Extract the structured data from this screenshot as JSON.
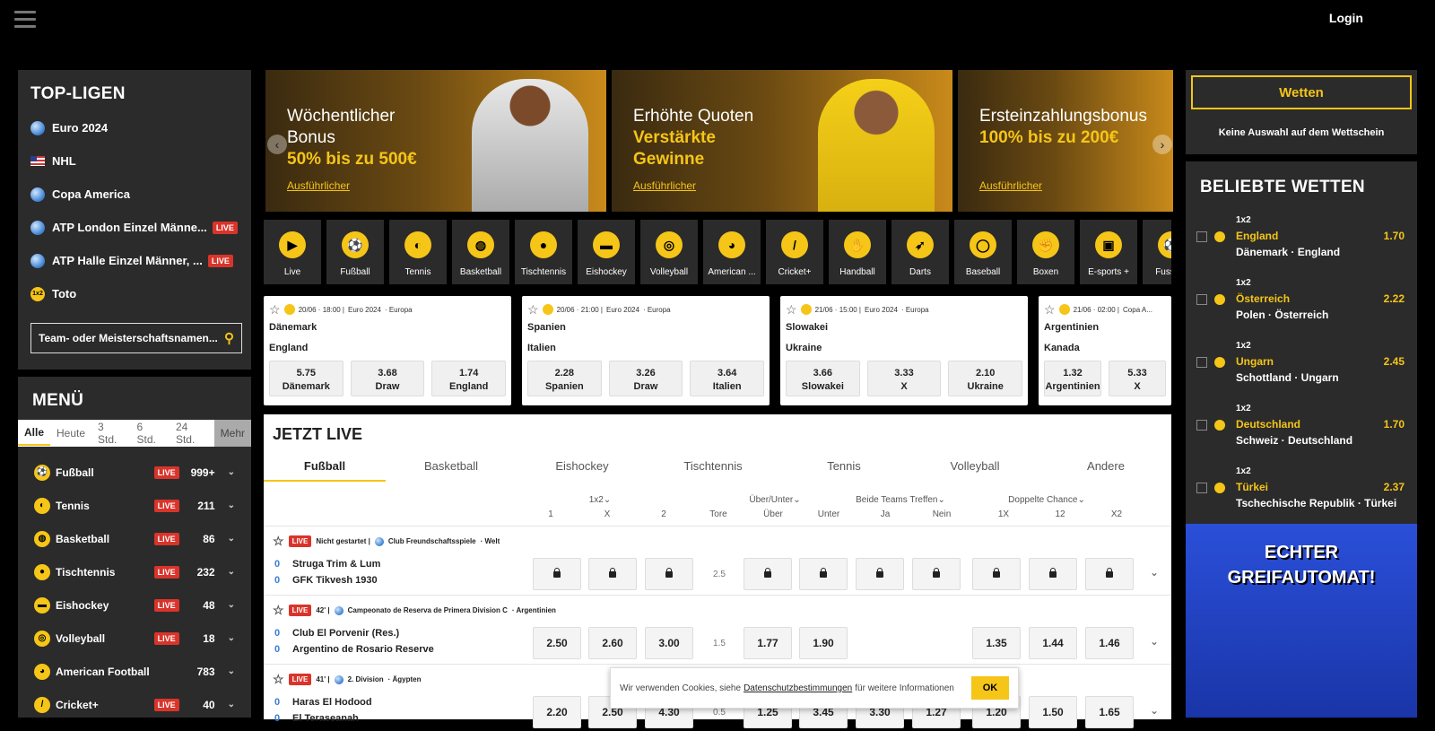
{
  "header": {
    "login": "Login"
  },
  "top_leagues": {
    "title": "TOP-LIGEN",
    "items": [
      {
        "label": "Euro 2024",
        "icon": "globe-icon",
        "live": ""
      },
      {
        "label": "NHL",
        "icon": "us-flag-icon",
        "live": ""
      },
      {
        "label": "Copa America",
        "icon": "globe-icon",
        "live": ""
      },
      {
        "label": "ATP London Einzel Männe...",
        "icon": "globe-icon",
        "live": "LIVE"
      },
      {
        "label": "ATP Halle Einzel Männer, ...",
        "icon": "globe-icon",
        "live": "LIVE"
      },
      {
        "label": "Toto",
        "icon": "toto-icon",
        "live": ""
      }
    ],
    "search_placeholder": "Team- oder Meisterschaftsnamen..."
  },
  "menu": {
    "title": "MENÜ",
    "tabs": [
      "Alle",
      "Heute",
      "3 Std.",
      "6 Std.",
      "24 Std.",
      "Mehr"
    ],
    "items": [
      {
        "label": "Fußball",
        "live": "LIVE",
        "count": "999+"
      },
      {
        "label": "Tennis",
        "live": "LIVE",
        "count": "211"
      },
      {
        "label": "Basketball",
        "live": "LIVE",
        "count": "86"
      },
      {
        "label": "Tischtennis",
        "live": "LIVE",
        "count": "232"
      },
      {
        "label": "Eishockey",
        "live": "LIVE",
        "count": "48"
      },
      {
        "label": "Volleyball",
        "live": "LIVE",
        "count": "18"
      },
      {
        "label": "American Football",
        "live": "",
        "count": "783"
      },
      {
        "label": "Cricket+",
        "live": "LIVE",
        "count": "40"
      }
    ]
  },
  "banners": [
    {
      "line1": "Wöchentlicher",
      "line2": "Bonus",
      "line3": "50% bis zu 500€",
      "line4": "",
      "more": "Ausführlicher"
    },
    {
      "line1": "Erhöhte Quoten",
      "line2": "",
      "line3": "Verstärkte",
      "line4": "Gewinne",
      "more": "Ausführlicher"
    },
    {
      "line1": "Ersteinzahlungsbonus",
      "line2": "",
      "line3": "100% bis zu 200€",
      "line4": "",
      "more": "Ausführlicher"
    }
  ],
  "sports": [
    "Live",
    "Fußball",
    "Tennis",
    "Basketball",
    "Tischtennis",
    "Eishockey",
    "Volleyball",
    "American ...",
    "Cricket+",
    "Handball",
    "Darts",
    "Baseball",
    "Boxen",
    "E-sports +",
    "Fussb..."
  ],
  "cards": [
    {
      "date": "20/06 · 18:00 |",
      "league": "Euro 2024",
      "region": "· Europa",
      "home": "Dänemark",
      "away": "England",
      "o": [
        "5.75",
        "3.68",
        "1.74"
      ],
      "l": [
        "Dänemark",
        "Draw",
        "England"
      ]
    },
    {
      "date": "20/06 · 21:00 |",
      "league": "Euro 2024",
      "region": "· Europa",
      "home": "Spanien",
      "away": "Italien",
      "o": [
        "2.28",
        "3.26",
        "3.64"
      ],
      "l": [
        "Spanien",
        "Draw",
        "Italien"
      ]
    },
    {
      "date": "21/06 · 15:00 |",
      "league": "Euro 2024",
      "region": "· Europa",
      "home": "Slowakei",
      "away": "Ukraine",
      "o": [
        "3.66",
        "3.33",
        "2.10"
      ],
      "l": [
        "Slowakei",
        "X",
        "Ukraine"
      ]
    },
    {
      "date": "21/06 · 02:00 |",
      "league": "Copa A...",
      "region": "",
      "home": "Argentinien",
      "away": "Kanada",
      "o": [
        "1.32",
        "5.33",
        ""
      ],
      "l": [
        "Argentinien",
        "X",
        ""
      ]
    }
  ],
  "live": {
    "title": "JETZT LIVE",
    "tabs": [
      "Fußball",
      "Basketball",
      "Eishockey",
      "Tischtennis",
      "Tennis",
      "Volleyball",
      "Andere"
    ],
    "groups": [
      "1x2",
      "Über/Unter",
      "Beide Teams Treffen",
      "Doppelte Chance"
    ],
    "cols": [
      "1",
      "X",
      "2",
      "Tore",
      "Über",
      "Unter",
      "Ja",
      "Nein",
      "1X",
      "12",
      "X2"
    ],
    "rows": [
      {
        "live": "LIVE",
        "time": "Nicht gestartet |",
        "league": "Club Freundschaftsspiele",
        "region": "· Welt",
        "home": "Struga Trim & Lum",
        "away": "GFK Tikvesh 1930",
        "sh": "0",
        "sa": "0",
        "line": "2.5",
        "odds": [
          "",
          "",
          "",
          "",
          "",
          "",
          "",
          "",
          "",
          ""
        ]
      },
      {
        "live": "LIVE",
        "time": "42' |",
        "league": "Campeonato de Reserva de Primera Division C",
        "region": "· Argentinien",
        "home": "Club El Porvenir (Res.)",
        "away": "Argentino de Rosario Reserve",
        "sh": "0",
        "sa": "0",
        "line": "1.5",
        "odds": [
          "2.50",
          "2.60",
          "3.00",
          "1.77",
          "1.90",
          "",
          "",
          "1.35",
          "1.44",
          "1.46"
        ]
      },
      {
        "live": "LIVE",
        "time": "41' |",
        "league": "2. Division",
        "region": "· Ägypten",
        "home": "Haras El Hodood",
        "away": "El Teraseanah",
        "sh": "0",
        "sa": "0",
        "line": "0.5",
        "odds": [
          "2.20",
          "2.50",
          "4.30",
          "1.25",
          "3.45",
          "3.30",
          "1.27",
          "1.20",
          "1.50",
          "1.65"
        ]
      }
    ]
  },
  "betslip": {
    "button": "Wetten",
    "empty": "Keine Auswahl auf dem Wettschein"
  },
  "popular": {
    "title": "BELIEBTE WETTEN",
    "items": [
      {
        "market": "1x2",
        "sel": "England",
        "odd": "1.70",
        "match": "Dänemark · England"
      },
      {
        "market": "1x2",
        "sel": "Österreich",
        "odd": "2.22",
        "match": "Polen · Österreich"
      },
      {
        "market": "1x2",
        "sel": "Ungarn",
        "odd": "2.45",
        "match": "Schottland · Ungarn"
      },
      {
        "market": "1x2",
        "sel": "Deutschland",
        "odd": "1.70",
        "match": "Schweiz · Deutschland"
      },
      {
        "market": "1x2",
        "sel": "Türkei",
        "odd": "2.37",
        "match": "Tschechische Republik · Türkei"
      }
    ]
  },
  "ad": {
    "line1": "ECHTER",
    "line2": "GREIFAUTOMAT!"
  },
  "cookie": {
    "pre": "Wir verwenden Cookies, siehe",
    "link": "Datenschutzbestimmungen",
    "post": "für weitere Informationen",
    "ok": "OK"
  },
  "colors": {
    "accent": "#f5c518",
    "live": "#d9342b",
    "panel": "#2b2b2b"
  }
}
